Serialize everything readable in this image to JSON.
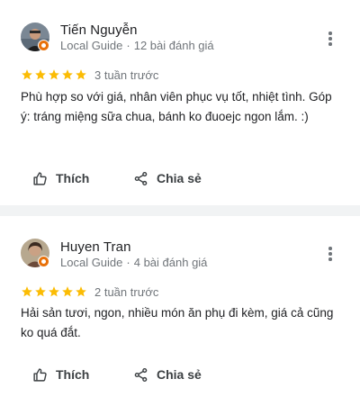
{
  "reviews": [
    {
      "author": "Tiến Nguyễn",
      "badge": "Local Guide",
      "review_count": "12 bài đánh giá",
      "rating": 5,
      "time": "3 tuần trước",
      "text": "Phù hợp so với giá, nhân viên phục vụ tốt, nhiệt tình. Góp ý: tráng miệng sữa chua, bánh ko đuoejc ngon lắm. :)",
      "like_label": "Thích",
      "share_label": "Chia sẻ"
    },
    {
      "author": "Huyen Tran",
      "badge": "Local Guide",
      "review_count": "4 bài đánh giá",
      "rating": 5,
      "time": "2 tuần trước",
      "text": "Hải sản tươi, ngon, nhiều món ăn phụ đi kèm, giá cả cũng ko quá đắt.",
      "like_label": "Thích",
      "share_label": "Chia sẻ"
    }
  ],
  "colors": {
    "star": "#fbbc04",
    "local_guide_badge": "#e8710a",
    "secondary_text": "#70757a",
    "separator": "#f1f3f4"
  },
  "icons": {
    "like": "thumb-up-outline",
    "share": "share-nodes",
    "more": "more-vertical"
  }
}
